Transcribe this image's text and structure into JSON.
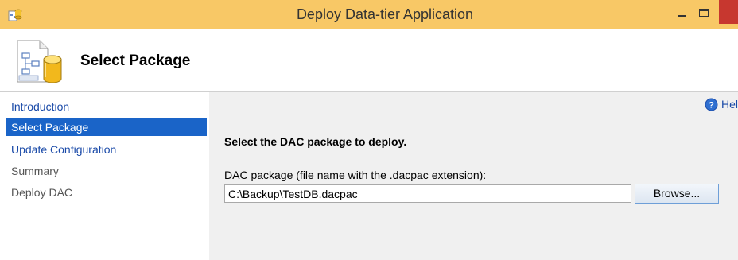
{
  "window": {
    "title": "Deploy Data-tier Application"
  },
  "header": {
    "title": "Select Package"
  },
  "sidebar": {
    "items": [
      {
        "label": "Introduction",
        "state": "link"
      },
      {
        "label": "Select Package",
        "state": "active"
      },
      {
        "label": "Update Configuration",
        "state": "link"
      },
      {
        "label": "Summary",
        "state": "disabled"
      },
      {
        "label": "Deploy DAC",
        "state": "disabled"
      }
    ]
  },
  "main": {
    "help_label": "Hel",
    "instruction": "Select the DAC package to deploy.",
    "field_label": "DAC package (file name with the .dacpac extension):",
    "path_value": "C:\\Backup\\TestDB.dacpac",
    "browse_label": "Browse..."
  },
  "colors": {
    "titlebar": "#f8c866",
    "selected": "#1a64c8",
    "link": "#1a4aa8",
    "close": "#c7372f"
  },
  "icons": {
    "app": "app-icon",
    "header": "database-diagram-icon",
    "help": "help-icon",
    "minimize": "minimize-icon",
    "maximize": "maximize-icon"
  }
}
